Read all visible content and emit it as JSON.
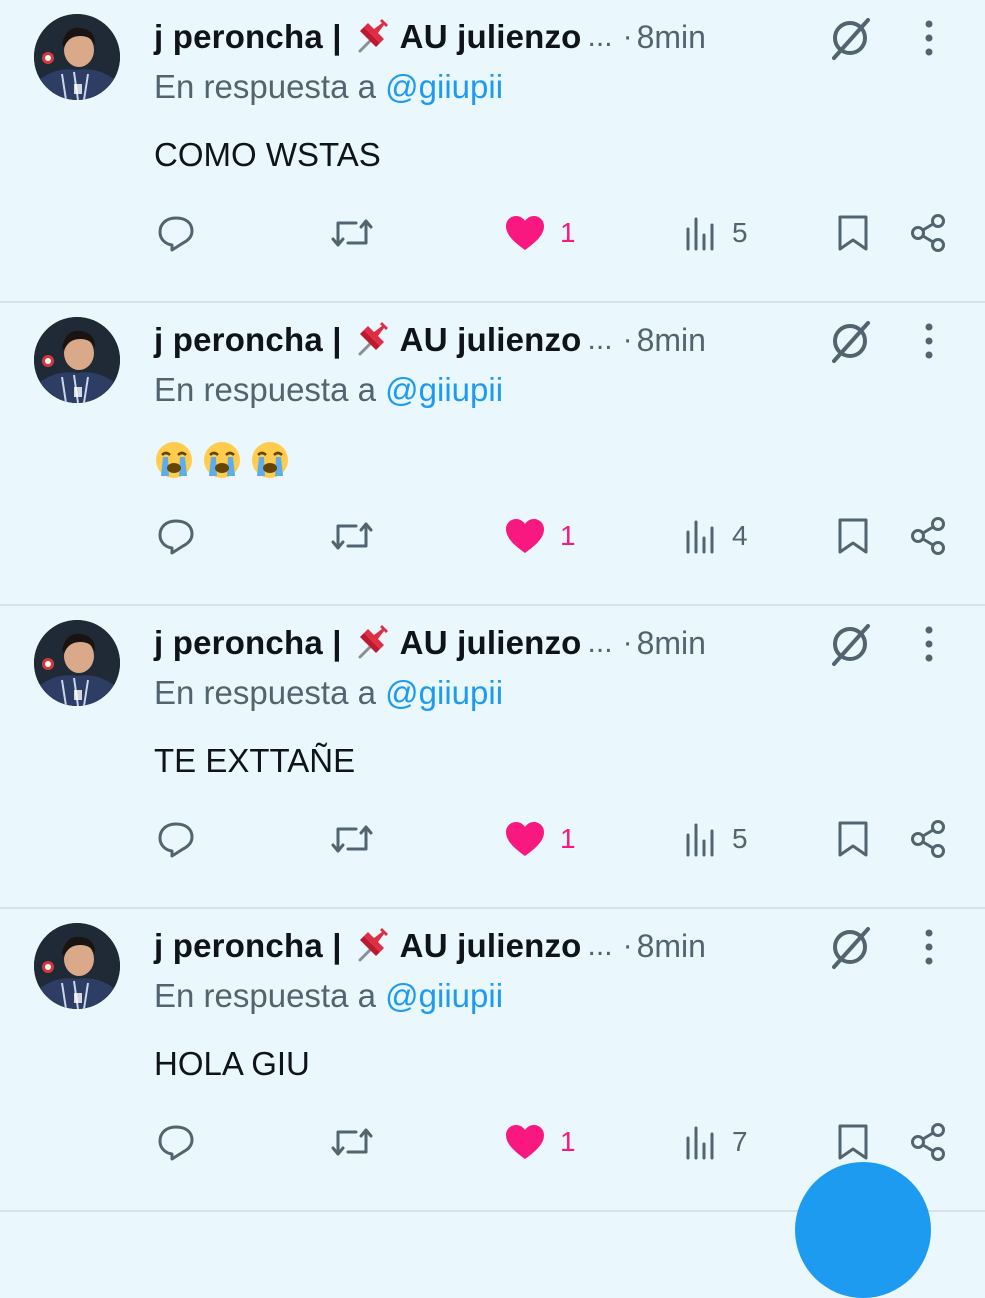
{
  "colors": {
    "background": "#eaf7fc",
    "mention": "#1d9bf0",
    "like": "#f91880",
    "muted": "#536471"
  },
  "icons": [
    "avatar",
    "pushpin-emoji",
    "grok-icon",
    "more-icon",
    "reply-icon",
    "retweet-icon",
    "heart-icon",
    "views-icon",
    "bookmark-icon",
    "share-icon",
    "loudly-crying-face-emoji"
  ],
  "tweets": [
    {
      "name": "j peroncha | ",
      "name_suffix": "AU julienzo",
      "ellipsis": "...",
      "dot": "·",
      "time": "8min",
      "reply_prefix": "En respuesta a ",
      "reply_to": "@giiupii",
      "text": "COMO WSTAS",
      "likes": "1",
      "views": "5"
    },
    {
      "name": "j peroncha | ",
      "name_suffix": "AU julienzo",
      "ellipsis": "...",
      "dot": "·",
      "time": "8min",
      "reply_prefix": "En respuesta a ",
      "reply_to": "@giiupii",
      "text": "😭😭😭",
      "likes": "1",
      "views": "4"
    },
    {
      "name": "j peroncha | ",
      "name_suffix": "AU julienzo",
      "ellipsis": "...",
      "dot": "·",
      "time": "8min",
      "reply_prefix": "En respuesta a ",
      "reply_to": "@giiupii",
      "text": "TE EXTTAÑE",
      "likes": "1",
      "views": "5"
    },
    {
      "name": "j peroncha | ",
      "name_suffix": "AU julienzo",
      "ellipsis": "...",
      "dot": "·",
      "time": "8min",
      "reply_prefix": "En respuesta a ",
      "reply_to": "@giiupii",
      "text": "HOLA GIU",
      "likes": "1",
      "views": "7"
    }
  ]
}
